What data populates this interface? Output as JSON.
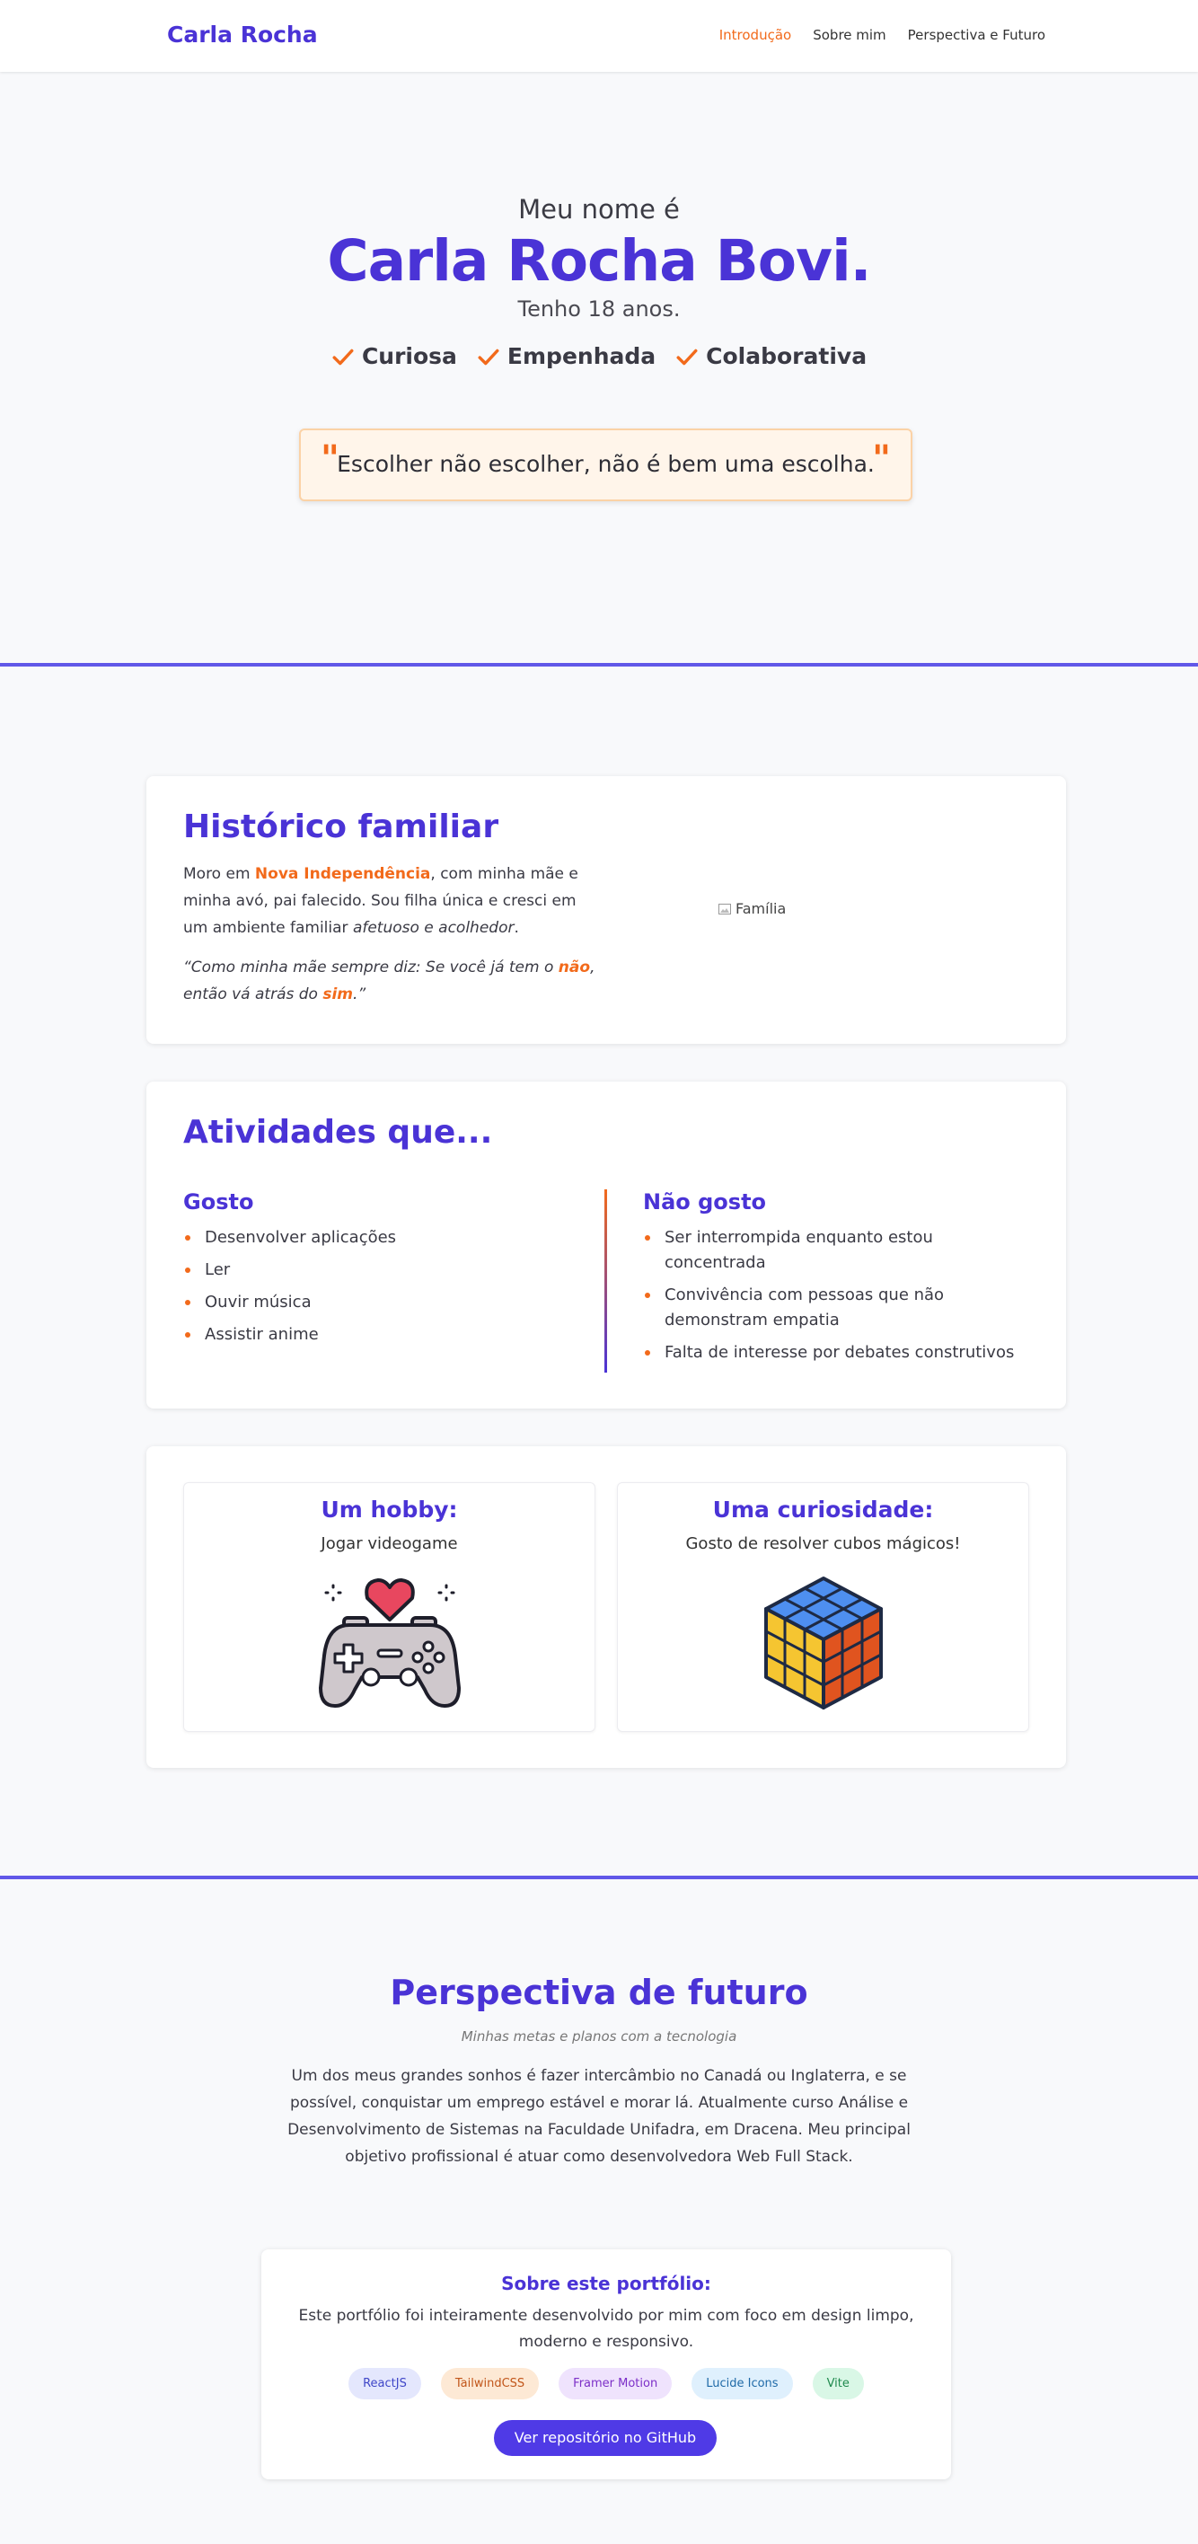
{
  "nav": {
    "brand": "Carla Rocha",
    "links": [
      "Introdução",
      "Sobre mim",
      "Perspectiva e Futuro"
    ]
  },
  "hero": {
    "intro": "Meu nome é",
    "name": "Carla Rocha Bovi.",
    "age": "Tenho 18 anos.",
    "traits": [
      "Curiosa",
      "Empenhada",
      "Colaborativa"
    ],
    "quote": "Escolher não escolher, não é bem uma escolha."
  },
  "family": {
    "title": "Histórico familiar",
    "p1_before": "Moro em ",
    "p1_highlight": "Nova Independência",
    "p1_after": ", com minha mãe e minha avó, pai falecido. Sou filha única e cresci em um ambiente familiar ",
    "p1_italic": "afetuoso e acolhedor",
    "p1_end": ".",
    "quote_before": "“Como minha mãe sempre diz: Se você já tem o ",
    "quote_hl1": "não",
    "quote_mid": ", então vá atrás do ",
    "quote_hl2": "sim",
    "quote_end": ".”",
    "image_alt": "Família"
  },
  "activities": {
    "title": "Atividades que...",
    "likes_title": "Gosto",
    "likes": [
      "Desenvolver aplicações",
      "Ler",
      "Ouvir música",
      "Assistir anime"
    ],
    "dislikes_title": "Não gosto",
    "dislikes": [
      "Ser interrompida enquanto estou concentrada",
      "Convivência com pessoas que não demonstram empatia",
      "Falta de interesse por debates construtivos"
    ]
  },
  "hobby": {
    "title": "Um hobby:",
    "text": "Jogar videogame",
    "icon": "gamepad-heart-icon"
  },
  "curiosity": {
    "title": "Uma curiosidade:",
    "text": "Gosto de resolver cubos mágicos!",
    "icon": "rubiks-cube-icon"
  },
  "future": {
    "title": "Perspectiva de futuro",
    "subtitle": "Minhas metas e planos com a tecnologia",
    "text": "Um dos meus grandes sonhos é fazer intercâmbio no Canadá ou Inglaterra, e se possível, conquistar um emprego estável e morar lá. Atualmente curso Análise e Desenvolvimento de Sistemas na Faculdade Unifadra, em Dracena. Meu principal objetivo profissional é atuar como desenvolvedora Web Full Stack."
  },
  "about": {
    "title": "Sobre este portfólio:",
    "text": "Este portfólio foi inteiramente desenvolvido por mim com foco em design limpo, moderno e responsivo.",
    "tags": [
      "ReactJS",
      "TailwindCSS",
      "Framer Motion",
      "Lucide Icons",
      "Vite"
    ],
    "button": "Ver repositório no GitHub"
  },
  "colors": {
    "primary": "#4a33d6",
    "accent": "#f26a1b",
    "divider": "#6158e8",
    "button": "#4f3ae6"
  }
}
